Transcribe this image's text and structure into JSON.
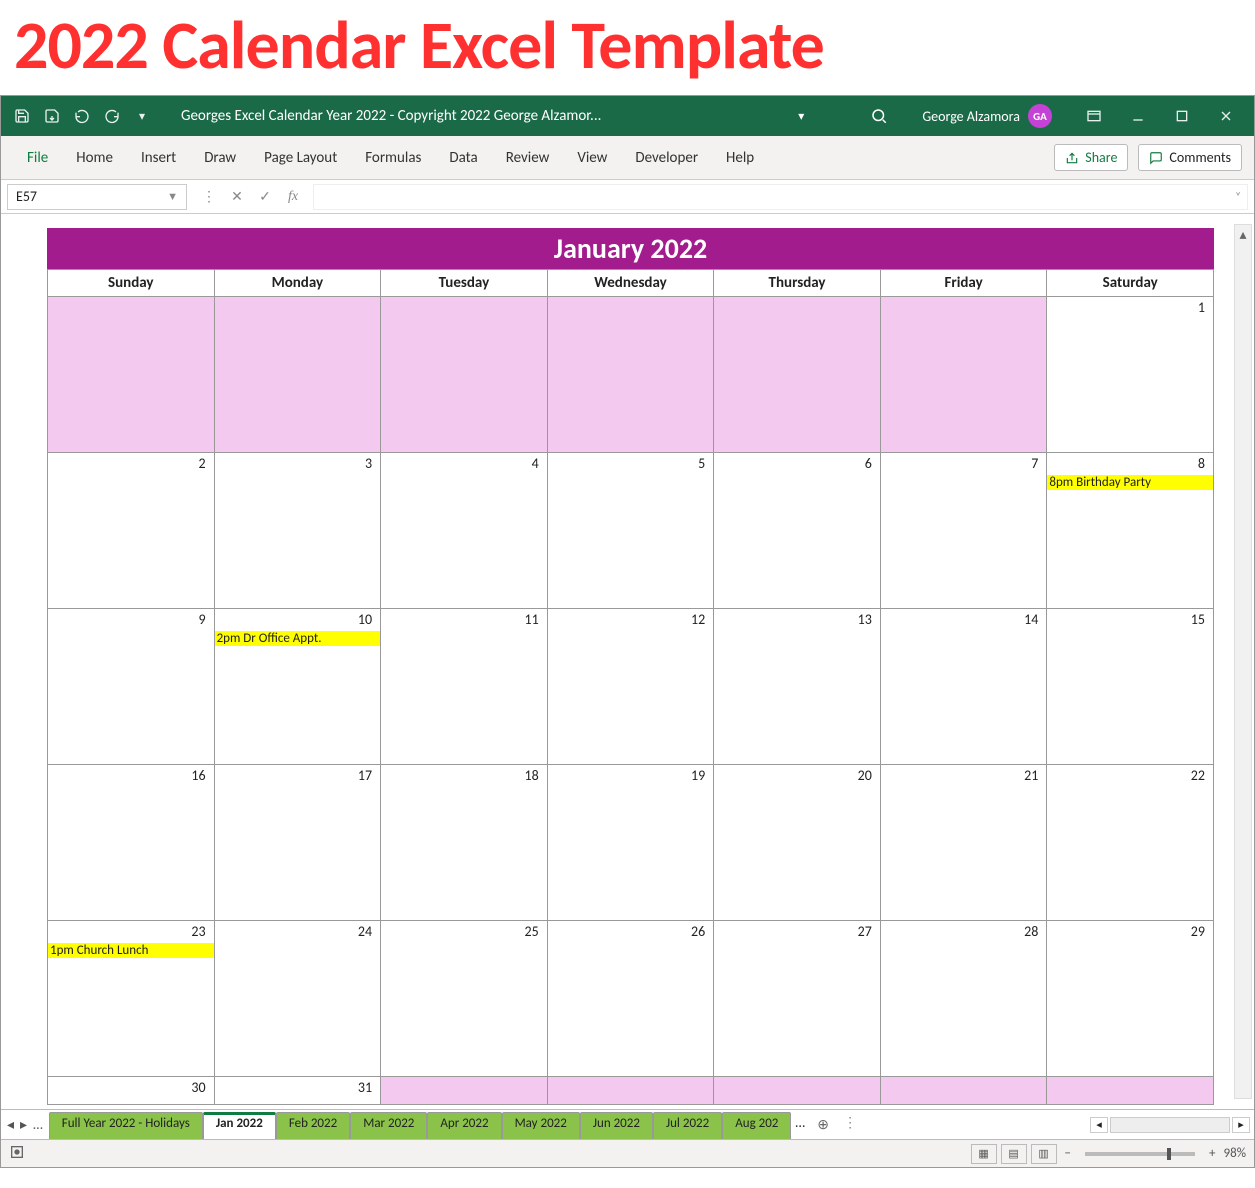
{
  "bigTitle": "2022 Calendar Excel Template",
  "titlebar": {
    "apptitle": "Georges Excel Calendar Year 2022 - Copyright 2022 George Alzamor...",
    "username": "George Alzamora",
    "avatar": "GA"
  },
  "ribbon": {
    "tabs": [
      "File",
      "Home",
      "Insert",
      "Draw",
      "Page Layout",
      "Formulas",
      "Data",
      "Review",
      "View",
      "Developer",
      "Help"
    ],
    "share": "Share",
    "comments": "Comments"
  },
  "formulabar": {
    "namebox": "E57",
    "fx": "fx"
  },
  "calendar": {
    "month": "January 2022",
    "dayHeaders": [
      "Sunday",
      "Monday",
      "Tuesday",
      "Wednesday",
      "Thursday",
      "Friday",
      "Saturday"
    ],
    "weeks": [
      [
        {
          "n": "",
          "pink": true
        },
        {
          "n": "",
          "pink": true
        },
        {
          "n": "",
          "pink": true
        },
        {
          "n": "",
          "pink": true
        },
        {
          "n": "",
          "pink": true
        },
        {
          "n": "",
          "pink": true
        },
        {
          "n": "1"
        }
      ],
      [
        {
          "n": "2"
        },
        {
          "n": "3"
        },
        {
          "n": "4"
        },
        {
          "n": "5"
        },
        {
          "n": "6"
        },
        {
          "n": "7"
        },
        {
          "n": "8",
          "event": "8pm Birthday Party"
        }
      ],
      [
        {
          "n": "9"
        },
        {
          "n": "10",
          "event": "2pm Dr Office Appt."
        },
        {
          "n": "11"
        },
        {
          "n": "12"
        },
        {
          "n": "13"
        },
        {
          "n": "14"
        },
        {
          "n": "15"
        }
      ],
      [
        {
          "n": "16"
        },
        {
          "n": "17"
        },
        {
          "n": "18"
        },
        {
          "n": "19"
        },
        {
          "n": "20"
        },
        {
          "n": "21"
        },
        {
          "n": "22"
        }
      ],
      [
        {
          "n": "23",
          "event": "1pm Church Lunch"
        },
        {
          "n": "24"
        },
        {
          "n": "25"
        },
        {
          "n": "26"
        },
        {
          "n": "27"
        },
        {
          "n": "28"
        },
        {
          "n": "29"
        }
      ],
      [
        {
          "n": "30"
        },
        {
          "n": "31"
        },
        {
          "n": "",
          "pink": true
        },
        {
          "n": "",
          "pink": true
        },
        {
          "n": "",
          "pink": true
        },
        {
          "n": "",
          "pink": true
        },
        {
          "n": "",
          "pink": true
        }
      ]
    ]
  },
  "sheetTabs": [
    "Full Year 2022 - Holidays",
    "Jan 2022",
    "Feb 2022",
    "Mar 2022",
    "Apr 2022",
    "May 2022",
    "Jun 2022",
    "Jul 2022",
    "Aug 202"
  ],
  "activeTab": "Jan 2022",
  "statusbar": {
    "zoom": "98%"
  }
}
